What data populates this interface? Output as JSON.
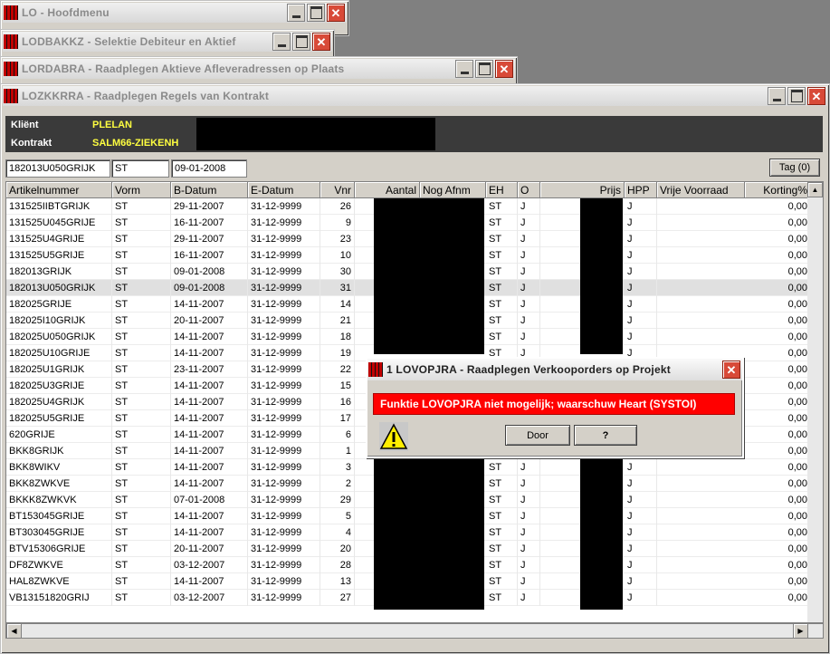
{
  "windows": {
    "w1": {
      "title": "LO - Hoofdmenu"
    },
    "w2": {
      "title": "LODBAKKZ - Selektie Debiteur en Aktief"
    },
    "w3": {
      "title": "LORDABRA - Raadplegen Aktieve Afleveradressen op Plaats"
    },
    "main": {
      "title": "LOZKKRRA - Raadplegen Regels van Kontrakt"
    }
  },
  "info": {
    "klient_label": "Kliënt",
    "klient_value": "PLELAN",
    "kontrakt_label": "Kontrakt",
    "kontrakt_value": "SALM66-ZIEKENH"
  },
  "filter": {
    "artikel": "182013U050GRIJK",
    "vorm": "ST",
    "datum": "09-01-2008",
    "tag_button": "Tag (0)"
  },
  "table": {
    "headers": [
      "Artikelnummer",
      "Vorm",
      "B-Datum",
      "E-Datum",
      "Vnr",
      "Aantal",
      "Nog Afnm",
      "EH",
      "O",
      "Prijs",
      "HPP",
      "Vrije Voorraad",
      "Korting%"
    ],
    "rows": [
      [
        "131525IIBTGRIJK",
        "ST",
        "29-11-2007",
        "31-12-9999",
        "26",
        "ST",
        "J",
        "J",
        "0,00"
      ],
      [
        "131525U045GRIJE",
        "ST",
        "16-11-2007",
        "31-12-9999",
        "9",
        "ST",
        "J",
        "J",
        "0,00"
      ],
      [
        "131525U4GRIJE",
        "ST",
        "29-11-2007",
        "31-12-9999",
        "23",
        "ST",
        "J",
        "J",
        "0,00"
      ],
      [
        "131525U5GRIJE",
        "ST",
        "16-11-2007",
        "31-12-9999",
        "10",
        "ST",
        "J",
        "J",
        "0,00"
      ],
      [
        "182013GRIJK",
        "ST",
        "09-01-2008",
        "31-12-9999",
        "30",
        "ST",
        "J",
        "J",
        "0,00"
      ],
      [
        "182013U050GRIJK",
        "ST",
        "09-01-2008",
        "31-12-9999",
        "31",
        "ST",
        "J",
        "J",
        "0,00"
      ],
      [
        "182025GRIJE",
        "ST",
        "14-11-2007",
        "31-12-9999",
        "14",
        "ST",
        "J",
        "J",
        "0,00"
      ],
      [
        "182025I10GRIJK",
        "ST",
        "20-11-2007",
        "31-12-9999",
        "21",
        "ST",
        "J",
        "J",
        "0,00"
      ],
      [
        "182025U050GRIJK",
        "ST",
        "14-11-2007",
        "31-12-9999",
        "18",
        "ST",
        "J",
        "J",
        "0,00"
      ],
      [
        "182025U10GRIJE",
        "ST",
        "14-11-2007",
        "31-12-9999",
        "19",
        "ST",
        "J",
        "J",
        "0,00"
      ],
      [
        "182025U1GRIJK",
        "ST",
        "23-11-2007",
        "31-12-9999",
        "22",
        "",
        "",
        "J",
        "0,00"
      ],
      [
        "182025U3GRIJE",
        "ST",
        "14-11-2007",
        "31-12-9999",
        "15",
        "",
        "",
        "J",
        "0,00"
      ],
      [
        "182025U4GRIJK",
        "ST",
        "14-11-2007",
        "31-12-9999",
        "16",
        "",
        "",
        "J",
        "0,00"
      ],
      [
        "182025U5GRIJE",
        "ST",
        "14-11-2007",
        "31-12-9999",
        "17",
        "",
        "",
        "J",
        "0,00"
      ],
      [
        "620GRIJE",
        "ST",
        "14-11-2007",
        "31-12-9999",
        "6",
        "",
        "",
        "J",
        "0,00"
      ],
      [
        "BKK8GRIJK",
        "ST",
        "14-11-2007",
        "31-12-9999",
        "1",
        "",
        "",
        "J",
        "0,00"
      ],
      [
        "BKK8WIKV",
        "ST",
        "14-11-2007",
        "31-12-9999",
        "3",
        "ST",
        "J",
        "J",
        "0,00"
      ],
      [
        "BKK8ZWKVE",
        "ST",
        "14-11-2007",
        "31-12-9999",
        "2",
        "ST",
        "J",
        "J",
        "0,00"
      ],
      [
        "BKKK8ZWKVK",
        "ST",
        "07-01-2008",
        "31-12-9999",
        "29",
        "ST",
        "J",
        "J",
        "0,00"
      ],
      [
        "BT153045GRIJE",
        "ST",
        "14-11-2007",
        "31-12-9999",
        "5",
        "ST",
        "J",
        "J",
        "0,00"
      ],
      [
        "BT303045GRIJE",
        "ST",
        "14-11-2007",
        "31-12-9999",
        "4",
        "ST",
        "J",
        "J",
        "0,00"
      ],
      [
        "BTV15306GRIJE",
        "ST",
        "20-11-2007",
        "31-12-9999",
        "20",
        "ST",
        "J",
        "J",
        "0,00"
      ],
      [
        "DF8ZWKVE",
        "ST",
        "03-12-2007",
        "31-12-9999",
        "28",
        "ST",
        "J",
        "J",
        "0,00"
      ],
      [
        "HAL8ZWKVE",
        "ST",
        "14-11-2007",
        "31-12-9999",
        "13",
        "ST",
        "J",
        "J",
        "0,00"
      ],
      [
        "VB13151820GRIJ",
        "ST",
        "03-12-2007",
        "31-12-9999",
        "27",
        "ST",
        "J",
        "J",
        "0,00"
      ]
    ]
  },
  "dialog": {
    "title": "1 LOVOPJRA - Raadplegen Verkooporders op Projekt",
    "message": "Funktie LOVOPJRA niet mogelijk; waarschuw Heart (SYSTOI)",
    "door_button": "Door",
    "help_button": "?"
  }
}
